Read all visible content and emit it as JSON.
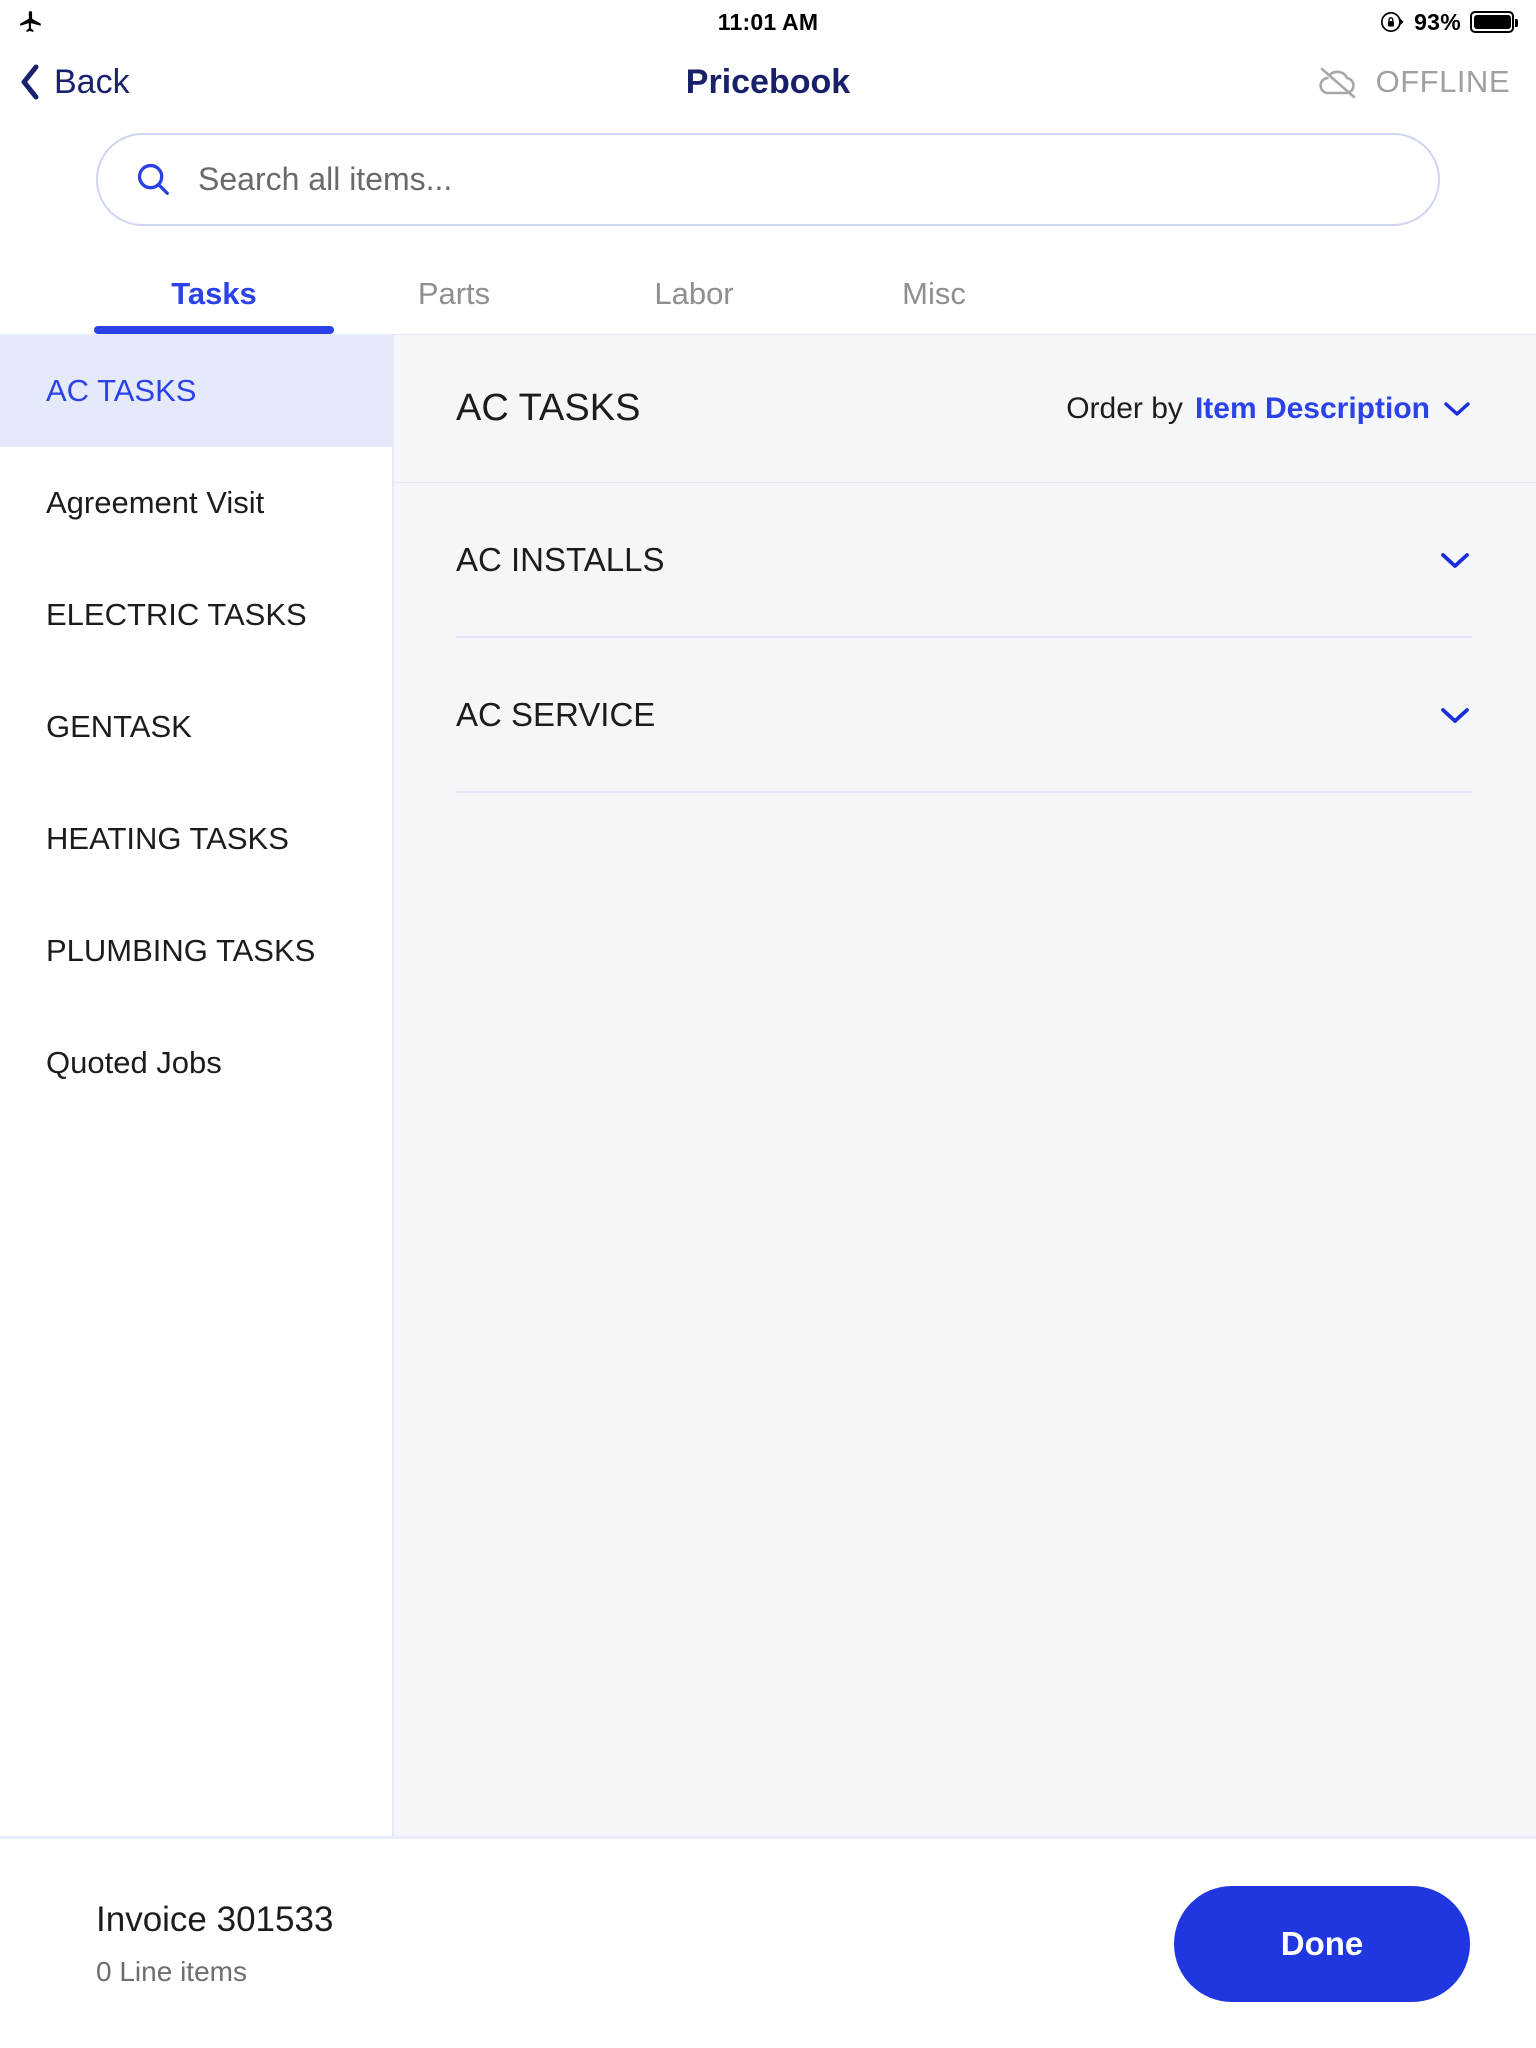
{
  "status_bar": {
    "airplane_icon": "airplane-mode-icon",
    "time": "11:01 AM",
    "rotation_lock_icon": "rotation-lock-icon",
    "battery_percent": "93%",
    "battery_level": 93
  },
  "nav": {
    "back_label": "Back",
    "title": "Pricebook",
    "offline_label": "OFFLINE",
    "offline_icon": "cloud-offline-icon"
  },
  "search": {
    "icon": "search-icon",
    "placeholder": "Search all items...",
    "value": ""
  },
  "tabs": [
    {
      "label": "Tasks",
      "active": true
    },
    {
      "label": "Parts",
      "active": false
    },
    {
      "label": "Labor",
      "active": false
    },
    {
      "label": "Misc",
      "active": false
    }
  ],
  "sidebar": {
    "items": [
      {
        "label": "AC TASKS",
        "active": true
      },
      {
        "label": "Agreement Visit",
        "active": false
      },
      {
        "label": "ELECTRIC TASKS",
        "active": false
      },
      {
        "label": "GENTASK",
        "active": false
      },
      {
        "label": "HEATING TASKS",
        "active": false
      },
      {
        "label": "PLUMBING TASKS",
        "active": false
      },
      {
        "label": "Quoted Jobs",
        "active": false
      }
    ]
  },
  "content": {
    "title": "AC TASKS",
    "order_by_label": "Order by",
    "order_by_value": "Item Description",
    "order_by_chevron": "chevron-down-icon",
    "groups": [
      {
        "label": "AC INSTALLS",
        "expanded": false
      },
      {
        "label": "AC SERVICE",
        "expanded": false
      }
    ]
  },
  "bottom_bar": {
    "invoice_title": "Invoice 301533",
    "line_items_text": "0 Line items",
    "done_label": "Done"
  },
  "colors": {
    "accent_blue": "#2A42E8",
    "nav_navy": "#18206A",
    "done_button": "#2036DF",
    "sidebar_active_bg": "#E5E9FA",
    "content_bg": "#F5F6F9",
    "muted_text": "#8E8E93",
    "divider": "#E2E7F5"
  }
}
